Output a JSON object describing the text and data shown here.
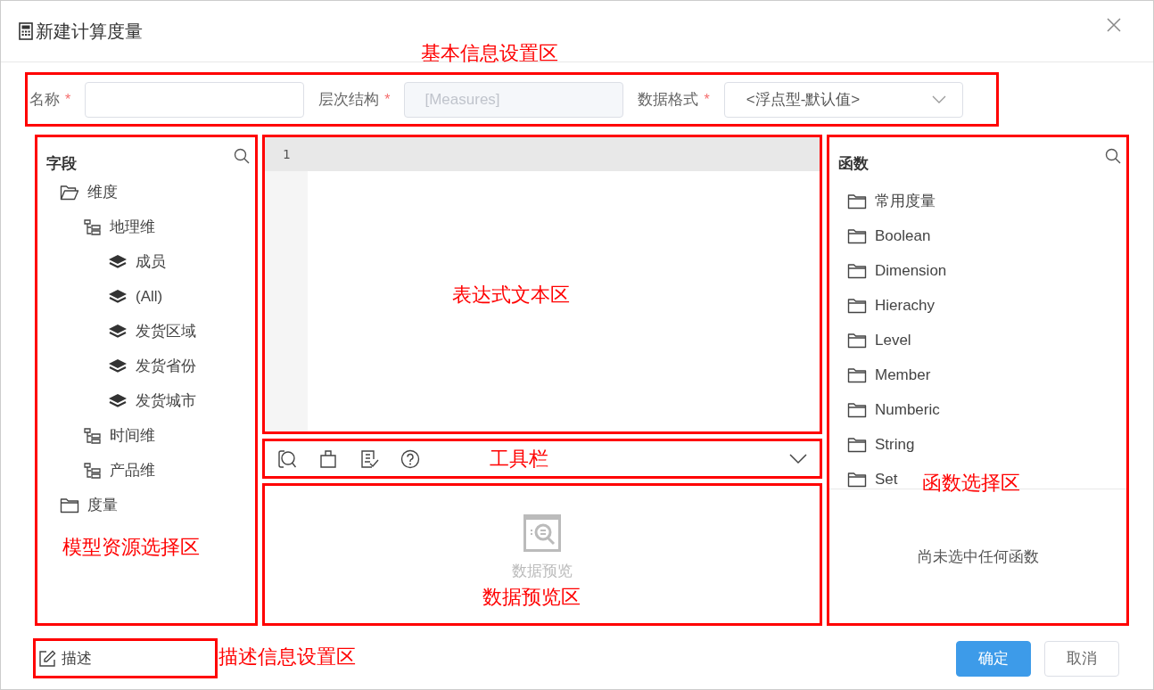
{
  "dialog": {
    "title": "新建计算度量"
  },
  "form": [
    {
      "kind": "input",
      "label": "名称",
      "required_mark": "*"
    },
    {
      "kind": "input",
      "label": "层次结构",
      "required_mark": "*",
      "value": "[Measures]",
      "disabled": true
    },
    {
      "kind": "select",
      "label": "数据格式",
      "required_mark": "*",
      "value": "<浮点型-默认值>"
    }
  ],
  "fields": {
    "title": "字段",
    "items": [
      {
        "kind": "folder",
        "label": "维度",
        "expanded": true,
        "children": [
          {
            "kind": "hierarchy",
            "label": "地理维",
            "expanded": true,
            "children": [
              {
                "kind": "level",
                "label": "成员"
              },
              {
                "kind": "level",
                "label": "(All)"
              },
              {
                "kind": "level",
                "label": "发货区域"
              },
              {
                "kind": "level",
                "label": "发货省份"
              },
              {
                "kind": "level",
                "label": "发货城市"
              }
            ]
          },
          {
            "kind": "hierarchy",
            "label": "时间维"
          },
          {
            "kind": "hierarchy",
            "label": "产品维"
          }
        ]
      },
      {
        "kind": "folder",
        "label": "度量",
        "expanded": false
      }
    ]
  },
  "editor": {
    "line_numbers": [
      "1"
    ]
  },
  "toolbar": {
    "tools": [
      {
        "kind": "preview"
      },
      {
        "kind": "format"
      },
      {
        "kind": "check"
      },
      {
        "kind": "help"
      }
    ]
  },
  "preview": {
    "placeholder": "数据预览"
  },
  "functions": {
    "title": "函数",
    "items": [
      "常用度量",
      "Boolean",
      "Dimension",
      "Hierachy",
      "Level",
      "Member",
      "Numberic",
      "String",
      "Set"
    ],
    "empty_message": "尚未选中任何函数"
  },
  "footer": {
    "description": "描述",
    "buttons": [
      {
        "label": "确定",
        "primary": true
      },
      {
        "label": "取消",
        "primary": false
      }
    ]
  },
  "annotations": {
    "form": "基本信息设置区",
    "editor": "表达式文本区",
    "toolbar": "工具栏",
    "functions": "函数选择区",
    "fields": "模型资源选择区",
    "preview": "数据预览区",
    "description": "描述信息设置区"
  }
}
